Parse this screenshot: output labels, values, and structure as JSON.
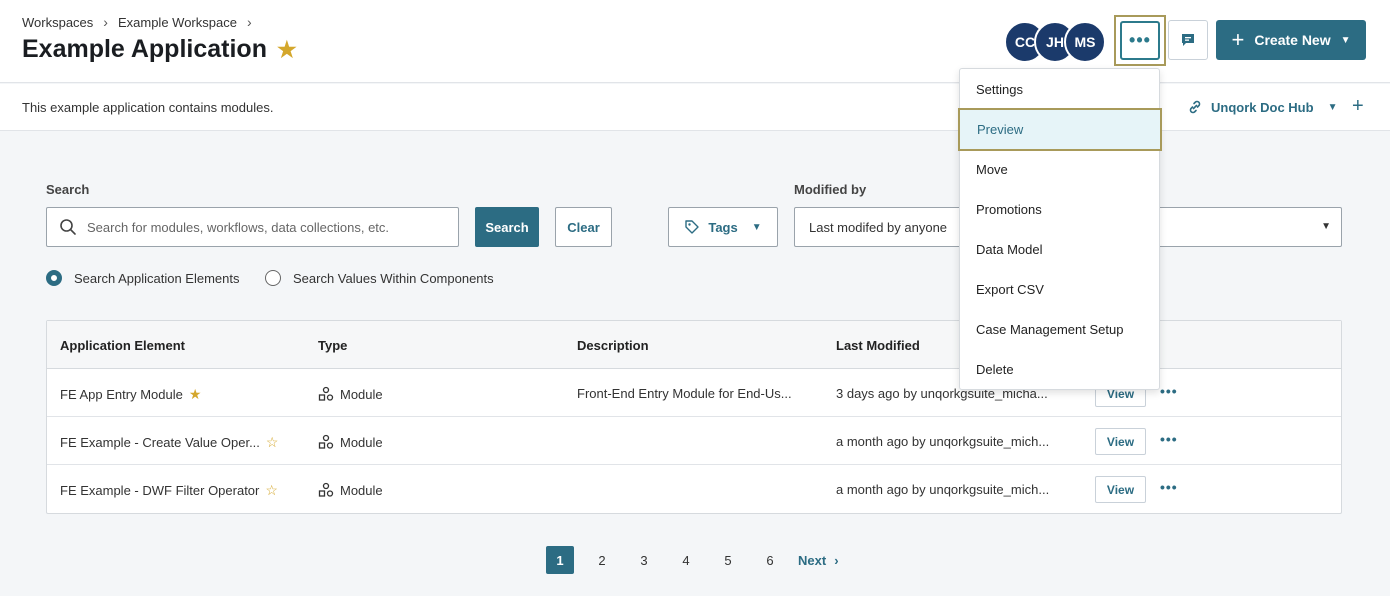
{
  "breadcrumb": {
    "items": [
      "Workspaces",
      "Example Workspace"
    ]
  },
  "page": {
    "title": "Example Application",
    "description": "This example application contains modules."
  },
  "avatars": [
    "CC",
    "JH",
    "MS"
  ],
  "header": {
    "create_label": "Create New",
    "more_label": "•••"
  },
  "doc_hub": {
    "label": "Unqork Doc Hub",
    "add": "+"
  },
  "search": {
    "label": "Search",
    "placeholder": "Search for modules, workflows, data collections, etc.",
    "search_button": "Search",
    "clear_button": "Clear",
    "tags_button": "Tags",
    "modified_label": "Modified by",
    "modified_value": "Last modifed by anyone",
    "radio_1": "Search Application Elements",
    "radio_2": "Search Values Within Components"
  },
  "table": {
    "headers": [
      "Application Element",
      "Type",
      "Description",
      "Last Modified"
    ],
    "rows": [
      {
        "name": "FE App Entry Module",
        "type": "Module",
        "description": "Front-End Entry Module for End-Us...",
        "modified": "3 days ago by unqorkgsuite_micha...",
        "view": "View",
        "more": "•••"
      },
      {
        "name": "FE Example - Create Value Oper...",
        "type": "Module",
        "description": "",
        "modified": "a month ago by unqorkgsuite_mich...",
        "view": "View",
        "more": "•••"
      },
      {
        "name": "FE Example - DWF Filter Operator",
        "type": "Module",
        "description": "",
        "modified": "a month ago by unqorkgsuite_mich...",
        "view": "View",
        "more": "•••"
      }
    ]
  },
  "pagination": {
    "pages": [
      "1",
      "2",
      "3",
      "4",
      "5",
      "6"
    ],
    "current": "1",
    "next": "Next"
  },
  "menu": {
    "items": [
      "Settings",
      "Preview",
      "Move",
      "Promotions",
      "Data Model",
      "Export CSV",
      "Case Management Setup",
      "Delete"
    ],
    "highlighted": "Preview"
  },
  "colors": {
    "accent": "#2c6c83",
    "avatar": "#1b3a6b",
    "star": "#d4a72c",
    "highlight_border": "#a89a5a"
  }
}
